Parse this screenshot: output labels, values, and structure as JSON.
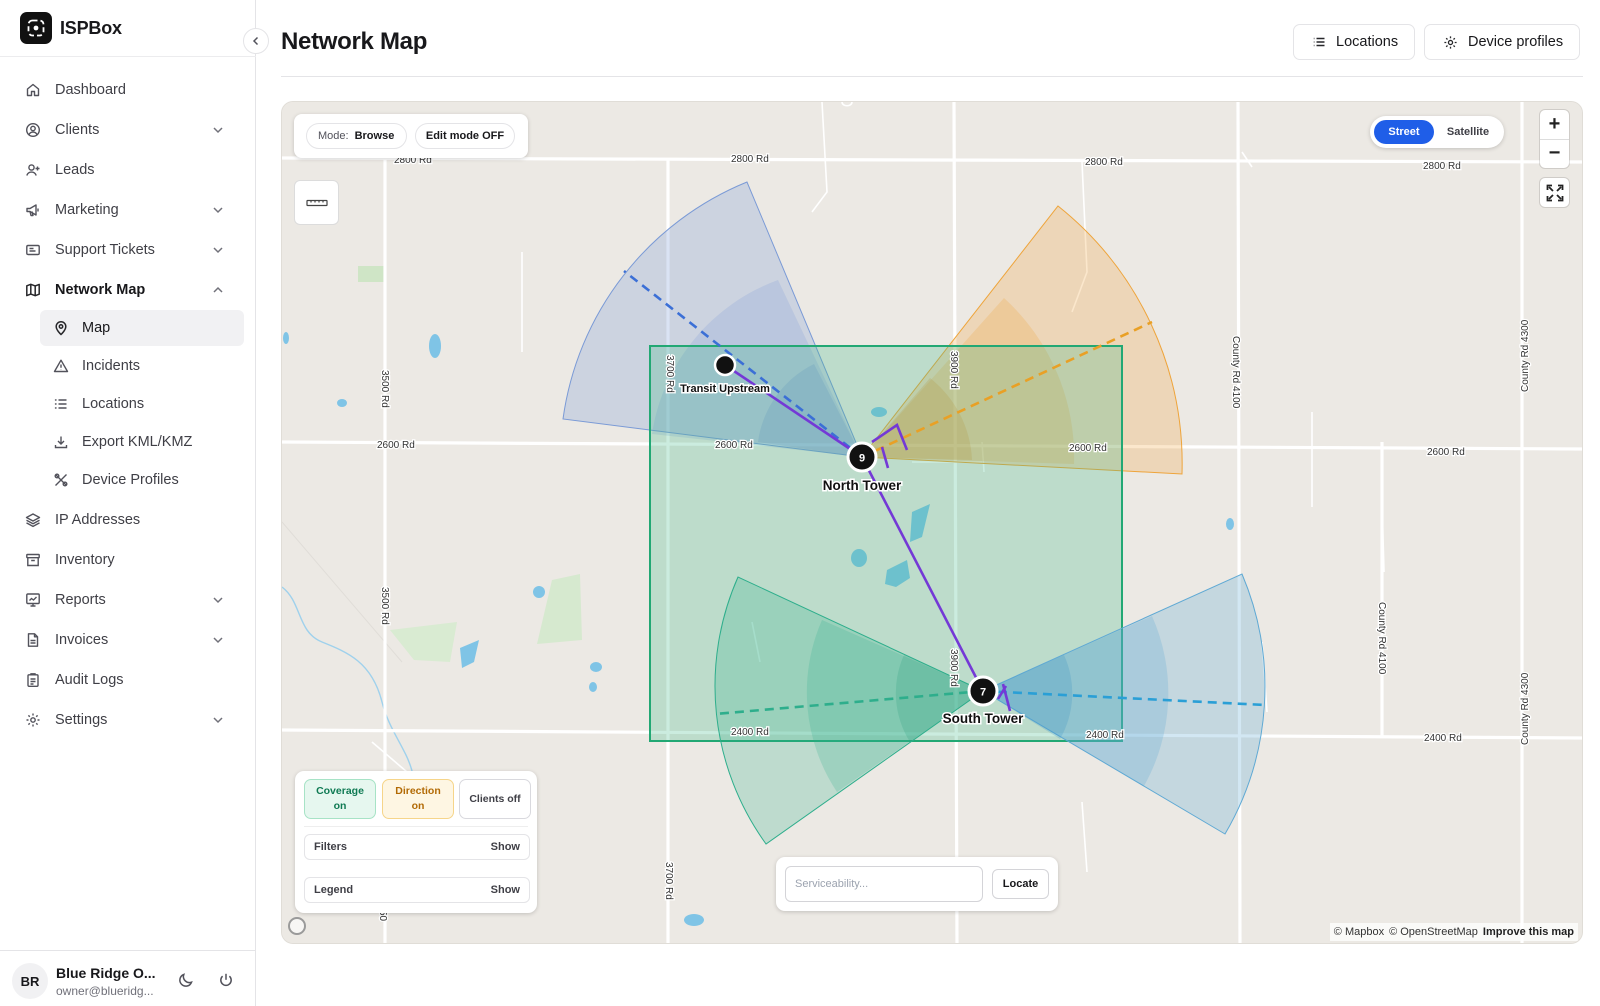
{
  "brand": {
    "name": "ISPBox"
  },
  "header": {
    "title": "Network Map",
    "locations_button": "Locations",
    "device_profiles_button": "Device profiles"
  },
  "sidebar": {
    "items": [
      {
        "label": "Dashboard",
        "icon": "home-icon"
      },
      {
        "label": "Clients",
        "icon": "user-circle-icon"
      },
      {
        "label": "Leads",
        "icon": "user-plus-icon"
      },
      {
        "label": "Marketing",
        "icon": "megaphone-icon"
      },
      {
        "label": "Support Tickets",
        "icon": "ticket-icon"
      },
      {
        "label": "Network Map",
        "icon": "map-icon"
      },
      {
        "label": "IP Addresses",
        "icon": "layers-icon"
      },
      {
        "label": "Inventory",
        "icon": "archive-icon"
      },
      {
        "label": "Reports",
        "icon": "report-icon"
      },
      {
        "label": "Invoices",
        "icon": "file-icon"
      },
      {
        "label": "Audit Logs",
        "icon": "clipboard-icon"
      },
      {
        "label": "Settings",
        "icon": "gear-icon"
      }
    ],
    "subitems": [
      {
        "label": "Map",
        "icon": "map-pin-icon"
      },
      {
        "label": "Incidents",
        "icon": "warning-icon"
      },
      {
        "label": "Locations",
        "icon": "list-icon"
      },
      {
        "label": "Export KML/KMZ",
        "icon": "download-icon"
      },
      {
        "label": "Device Profiles",
        "icon": "tools-icon"
      }
    ]
  },
  "user": {
    "initials": "BR",
    "name": "Blue Ridge O...",
    "email": "owner@blueridg..."
  },
  "map": {
    "mode_label": "Mode:",
    "mode_value": "Browse",
    "edit_mode": "Edit mode OFF",
    "style_options": [
      "Street",
      "Satellite"
    ],
    "style_selected": "Street",
    "zoom_in": "+",
    "zoom_out": "−",
    "layers": {
      "coverage": {
        "line1": "Coverage",
        "line2": "on"
      },
      "direction": {
        "line1": "Direction",
        "line2": "on"
      },
      "clients": "Clients off"
    },
    "filters": {
      "label": "Filters",
      "action": "Show"
    },
    "legend": {
      "label": "Legend",
      "action": "Show"
    },
    "serviceability": {
      "placeholder": "Serviceability...",
      "button": "Locate"
    },
    "attribution": {
      "mapbox": "© Mapbox",
      "osm": "© OpenStreetMap",
      "improve": "Improve this map"
    },
    "towers": [
      {
        "name": "Transit Upstream",
        "count": ""
      },
      {
        "name": "North Tower",
        "count": "9"
      },
      {
        "name": "South Tower",
        "count": "7"
      }
    ],
    "road_labels": {
      "h_2800": "2800 Rd",
      "h_2600": "2600 Rd",
      "h_2400": "2400 Rd",
      "v_3500": "3500 Rd",
      "v_3700": "3700 Rd",
      "v_3900": "3900 Rd",
      "v_cr4100": "County Rd 4100",
      "v_cr4300": "County Rd 4300",
      "v_50": "50"
    },
    "colors": {
      "sector_blue": "#7a9ad6",
      "sector_orange": "#eea43a",
      "sector_teal": "#2eae8c",
      "sector_lightblue": "#5fa9d4",
      "coverage_box": "#22a874",
      "backhaul": "#7439d6",
      "style_active": "#1f5ee8"
    }
  }
}
